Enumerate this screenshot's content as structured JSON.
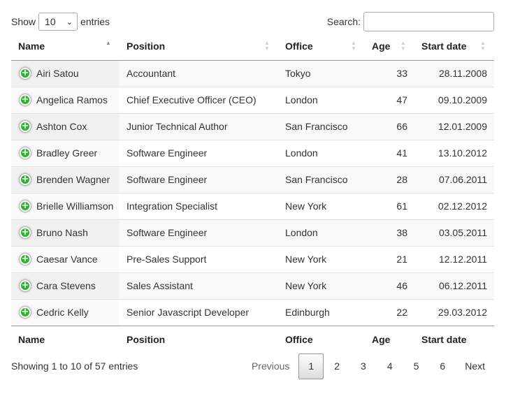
{
  "length": {
    "show_label": "Show",
    "selected": "10",
    "entries_label": "entries"
  },
  "search": {
    "label": "Search:",
    "value": ""
  },
  "columns": [
    "Name",
    "Position",
    "Office",
    "Age",
    "Start date"
  ],
  "rows": [
    {
      "name": "Airi Satou",
      "position": "Accountant",
      "office": "Tokyo",
      "age": "33",
      "start": "28.11.2008"
    },
    {
      "name": "Angelica Ramos",
      "position": "Chief Executive Officer (CEO)",
      "office": "London",
      "age": "47",
      "start": "09.10.2009"
    },
    {
      "name": "Ashton Cox",
      "position": "Junior Technical Author",
      "office": "San Francisco",
      "age": "66",
      "start": "12.01.2009"
    },
    {
      "name": "Bradley Greer",
      "position": "Software Engineer",
      "office": "London",
      "age": "41",
      "start": "13.10.2012"
    },
    {
      "name": "Brenden Wagner",
      "position": "Software Engineer",
      "office": "San Francisco",
      "age": "28",
      "start": "07.06.2011"
    },
    {
      "name": "Brielle Williamson",
      "position": "Integration Specialist",
      "office": "New York",
      "age": "61",
      "start": "02.12.2012"
    },
    {
      "name": "Bruno Nash",
      "position": "Software Engineer",
      "office": "London",
      "age": "38",
      "start": "03.05.2011"
    },
    {
      "name": "Caesar Vance",
      "position": "Pre-Sales Support",
      "office": "New York",
      "age": "21",
      "start": "12.12.2011"
    },
    {
      "name": "Cara Stevens",
      "position": "Sales Assistant",
      "office": "New York",
      "age": "46",
      "start": "06.12.2011"
    },
    {
      "name": "Cedric Kelly",
      "position": "Senior Javascript Developer",
      "office": "Edinburgh",
      "age": "22",
      "start": "29.03.2012"
    }
  ],
  "info": "Showing 1 to 10 of 57 entries",
  "pagination": {
    "previous": "Previous",
    "pages": [
      "1",
      "2",
      "3",
      "4",
      "5",
      "6"
    ],
    "current": "1",
    "next": "Next"
  },
  "icons": {
    "expand": "plus-circle-icon",
    "sort": "sort-arrows-icon"
  },
  "colors": {
    "expand_button": "#31b131",
    "sorted_column_odd": "#f1f1f1",
    "row_odd": "#f9f9f9"
  }
}
